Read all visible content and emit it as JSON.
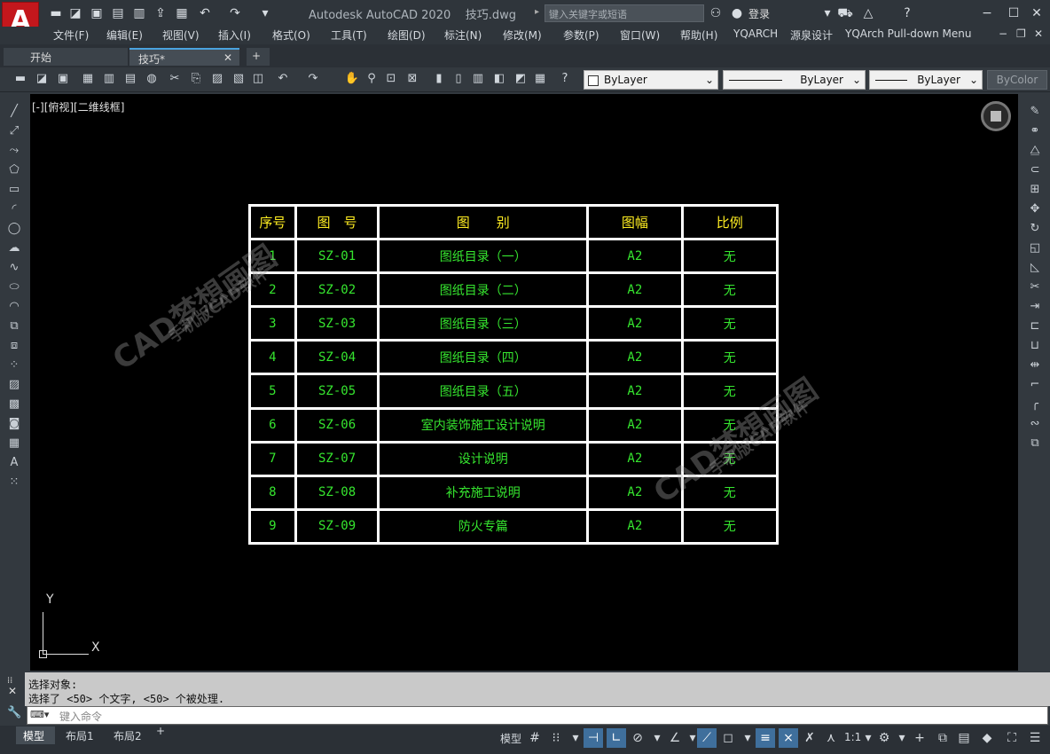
{
  "window": {
    "app_title": "Autodesk AutoCAD 2020",
    "file_title": "技巧.dwg",
    "search_placeholder": "键入关键字或短语",
    "login": "登录",
    "logo_letter": "A"
  },
  "menu": [
    "文件(F)",
    "编辑(E)",
    "视图(V)",
    "插入(I)",
    "格式(O)",
    "工具(T)",
    "绘图(D)",
    "标注(N)",
    "修改(M)",
    "参数(P)",
    "窗口(W)",
    "帮助(H)",
    "YQARCH",
    "源泉设计",
    "YQArch Pull-down Menu"
  ],
  "tabs": {
    "start": "开始",
    "file": "技巧*",
    "add": "+"
  },
  "properties": {
    "layer": "ByLayer",
    "linetype": "ByLayer",
    "lineweight": "ByLayer",
    "color": "ByColor"
  },
  "viewport_label": "[-][俯视][二维线框]",
  "table": {
    "headers": [
      "序号",
      "图　号",
      "图　　别",
      "图幅",
      "比例"
    ],
    "rows": [
      [
        "1",
        "SZ-01",
        "图纸目录（一）",
        "A2",
        "无"
      ],
      [
        "2",
        "SZ-02",
        "图纸目录（二）",
        "A2",
        "无"
      ],
      [
        "3",
        "SZ-03",
        "图纸目录（三）",
        "A2",
        "无"
      ],
      [
        "4",
        "SZ-04",
        "图纸目录（四）",
        "A2",
        "无"
      ],
      [
        "5",
        "SZ-05",
        "图纸目录（五）",
        "A2",
        "无"
      ],
      [
        "6",
        "SZ-06",
        "室内装饰施工设计说明",
        "A2",
        "无"
      ],
      [
        "7",
        "SZ-07",
        "设计说明",
        "A2",
        "无"
      ],
      [
        "8",
        "SZ-08",
        "补充施工说明",
        "A2",
        "无"
      ],
      [
        "9",
        "SZ-09",
        "防火专篇",
        "A2",
        "无"
      ]
    ],
    "header_color": "#ffee22",
    "cell_color": "#36e62f"
  },
  "watermark": {
    "main": "CAD梦想画图",
    "sub": "手机版CAD软件"
  },
  "ucs": {
    "x": "X",
    "y": "Y"
  },
  "command": {
    "line1": "选择对象:",
    "line2": "选择了 <50> 个文字, <50> 个被处理.",
    "placeholder": "键入命令"
  },
  "layouts": {
    "model": "模型",
    "layout1": "布局1",
    "layout2": "布局2",
    "add": "+"
  },
  "status": {
    "model_label": "模型",
    "scale": "1:1"
  }
}
